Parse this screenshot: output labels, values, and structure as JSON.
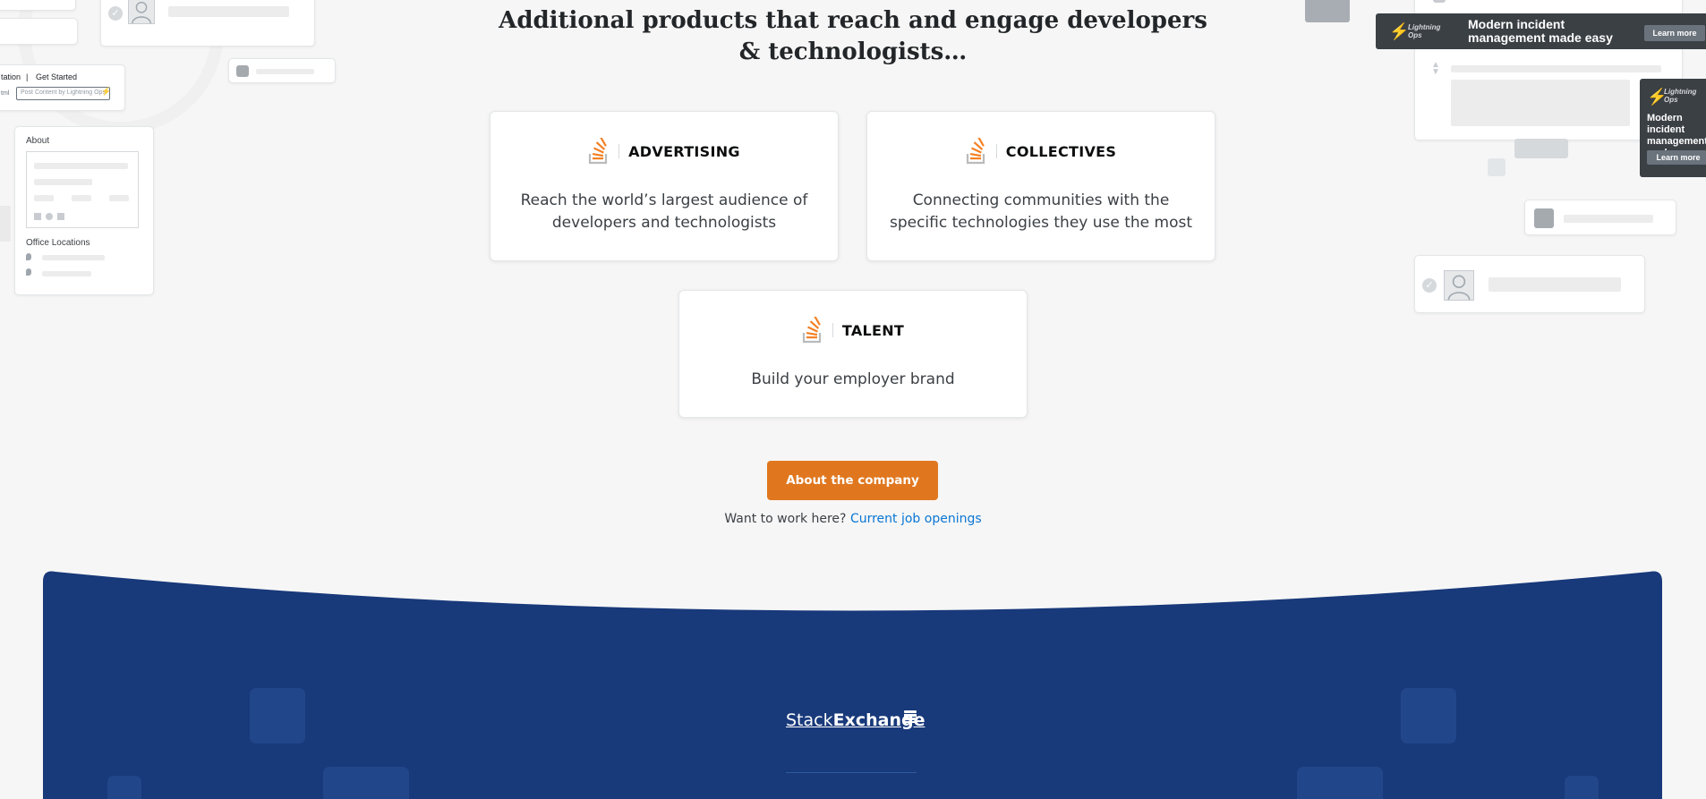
{
  "headline": "Additional products that reach and engage developers & technologists…",
  "products": [
    {
      "title": "ADVERTISING",
      "description": "Reach the world’s largest audience of developers and technologists"
    },
    {
      "title": "COLLECTIVES",
      "description": "Connecting communities with the specific technologies they use the most"
    },
    {
      "title": "TALENT",
      "description": "Build your employer brand"
    }
  ],
  "cta": {
    "label": "About the company"
  },
  "careers": {
    "prompt": "Want to work here?",
    "link_label": "Current job openings"
  },
  "footer": {
    "brand_light": "Stack",
    "brand_bold": "Exchange"
  },
  "mock_left": {
    "nav_items": [
      "tation",
      "|",
      "Get Started"
    ],
    "input_prefix": "tml",
    "input_placeholder": "Post Content by Lightning Ops",
    "about_label": "About",
    "office_label": "Office Locations"
  },
  "mock_ads": [
    {
      "brand": "Lightning Ops",
      "headline": "Modern incident management made easy",
      "button": "Learn more"
    },
    {
      "brand": "Lightning Ops",
      "headline": "Modern incident management made easy",
      "button": "Learn more"
    }
  ],
  "colors": {
    "accent": "#e0771f",
    "link": "#0a76d3",
    "footer_bg": "#18397a",
    "logo_orange": "#f48024",
    "logo_gray": "#bcbbbb"
  },
  "icons": [
    "stack-overflow-logo-icon",
    "check-icon",
    "user-silhouette-icon",
    "location-pin-icon",
    "facebook-icon",
    "twitter-icon",
    "linkedin-icon",
    "lightning-bolt-icon",
    "stack-exchange-icon"
  ]
}
